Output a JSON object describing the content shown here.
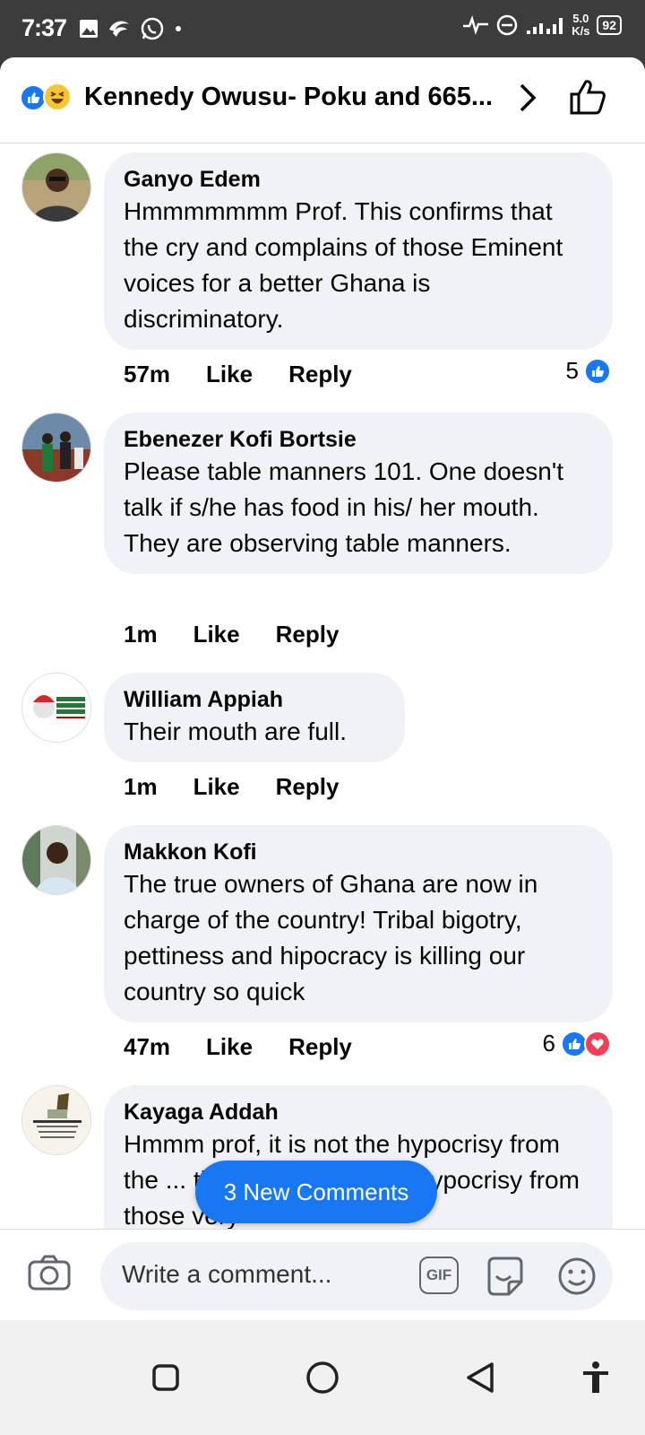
{
  "status_bar": {
    "time": "7:37",
    "network_speed_value": "5.0",
    "network_speed_unit": "K/s",
    "battery": "92"
  },
  "header": {
    "title": "Kennedy Owusu- Poku and 665..."
  },
  "comments": [
    {
      "name": "Ganyo Edem",
      "text": "Hmmmmmmm Prof. This confirms that the cry and complains of those Eminent voices for a better Ghana is discriminatory.",
      "time": "57m",
      "like_label": "Like",
      "reply_label": "Reply",
      "reaction_count": "5"
    },
    {
      "name": "Ebenezer Kofi Bortsie",
      "text": "Please table manners 101. One doesn't talk if s/he has food in his/ her mouth. They are observing table manners.",
      "time": "1m",
      "like_label": "Like",
      "reply_label": "Reply"
    },
    {
      "name": "William Appiah",
      "text": "Their mouth are full.",
      "time": "1m",
      "like_label": "Like",
      "reply_label": "Reply"
    },
    {
      "name": "Makkon Kofi",
      "text": "The true owners of Ghana are now in charge of the country! Tribal bigotry, pettiness and hipocracy is killing our country so quick",
      "time": "47m",
      "like_label": "Like",
      "reply_label": "Reply",
      "reaction_count": "6"
    },
    {
      "name": "Kayaga Addah",
      "text": "Hmmm prof, it is not the hypocrisy from the ... the problem but the hypocrisy from those very"
    }
  ],
  "new_comments_pill": "3 New Comments",
  "composer": {
    "placeholder": "Write a comment...",
    "gif_label": "GIF"
  },
  "colors": {
    "facebook_blue": "#1877f2",
    "bubble_bg": "#f0f2f5",
    "love_red": "#f33e58"
  }
}
